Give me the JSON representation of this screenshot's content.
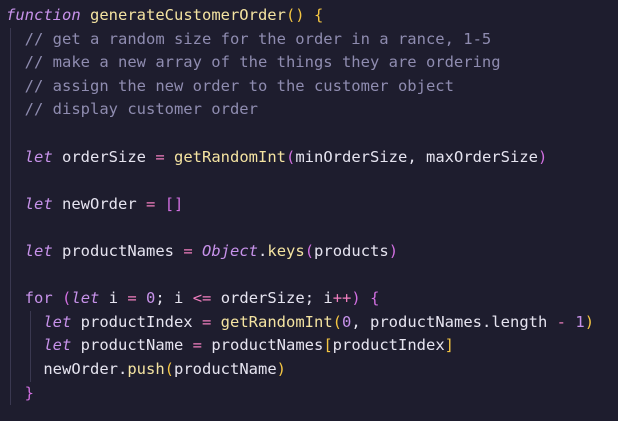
{
  "code": {
    "lines": [
      [
        {
          "c": "tok-kw",
          "t": "function"
        },
        {
          "c": "tok-var",
          "t": " "
        },
        {
          "c": "tok-fn",
          "t": "generateCustomerOrder"
        },
        {
          "c": "tok-paren",
          "t": "()"
        },
        {
          "c": "tok-var",
          "t": " "
        },
        {
          "c": "tok-brace",
          "t": "{"
        }
      ],
      [
        {
          "c": "tok-var",
          "t": "  "
        },
        {
          "c": "tok-comment",
          "t": "// get a random size for the order in a rance, 1-5"
        }
      ],
      [
        {
          "c": "tok-var",
          "t": "  "
        },
        {
          "c": "tok-comment",
          "t": "// make a new array of the things they are ordering"
        }
      ],
      [
        {
          "c": "tok-var",
          "t": "  "
        },
        {
          "c": "tok-comment",
          "t": "// assign the new order to the customer object"
        }
      ],
      [
        {
          "c": "tok-var",
          "t": "  "
        },
        {
          "c": "tok-comment",
          "t": "// display customer order"
        }
      ],
      [],
      [
        {
          "c": "tok-var",
          "t": "  "
        },
        {
          "c": "tok-kw",
          "t": "let"
        },
        {
          "c": "tok-var",
          "t": " orderSize "
        },
        {
          "c": "tok-op",
          "t": "="
        },
        {
          "c": "tok-var",
          "t": " "
        },
        {
          "c": "tok-fn",
          "t": "getRandomInt"
        },
        {
          "c": "tok-paren2",
          "t": "("
        },
        {
          "c": "tok-var",
          "t": "minOrderSize, maxOrderSize"
        },
        {
          "c": "tok-paren2",
          "t": ")"
        }
      ],
      [],
      [
        {
          "c": "tok-var",
          "t": "  "
        },
        {
          "c": "tok-kw",
          "t": "let"
        },
        {
          "c": "tok-var",
          "t": " newOrder "
        },
        {
          "c": "tok-op",
          "t": "="
        },
        {
          "c": "tok-var",
          "t": " "
        },
        {
          "c": "tok-bracket",
          "t": "[]"
        }
      ],
      [],
      [
        {
          "c": "tok-var",
          "t": "  "
        },
        {
          "c": "tok-kw",
          "t": "let"
        },
        {
          "c": "tok-var",
          "t": " productNames "
        },
        {
          "c": "tok-op",
          "t": "="
        },
        {
          "c": "tok-var",
          "t": " "
        },
        {
          "c": "tok-obj",
          "t": "Object"
        },
        {
          "c": "tok-punct",
          "t": "."
        },
        {
          "c": "tok-method",
          "t": "keys"
        },
        {
          "c": "tok-paren2",
          "t": "("
        },
        {
          "c": "tok-var",
          "t": "products"
        },
        {
          "c": "tok-paren2",
          "t": ")"
        }
      ],
      [],
      [
        {
          "c": "tok-var",
          "t": "  "
        },
        {
          "c": "tok-for",
          "t": "for"
        },
        {
          "c": "tok-var",
          "t": " "
        },
        {
          "c": "tok-paren2",
          "t": "("
        },
        {
          "c": "tok-kw",
          "t": "let"
        },
        {
          "c": "tok-var",
          "t": " i "
        },
        {
          "c": "tok-op",
          "t": "="
        },
        {
          "c": "tok-var",
          "t": " "
        },
        {
          "c": "tok-num",
          "t": "0"
        },
        {
          "c": "tok-punct",
          "t": "; i "
        },
        {
          "c": "tok-op",
          "t": "<="
        },
        {
          "c": "tok-var",
          "t": " orderSize; i"
        },
        {
          "c": "tok-op",
          "t": "++"
        },
        {
          "c": "tok-paren2",
          "t": ")"
        },
        {
          "c": "tok-var",
          "t": " "
        },
        {
          "c": "tok-brace2",
          "t": "{"
        }
      ],
      [
        {
          "c": "tok-var",
          "t": "    "
        },
        {
          "c": "tok-kw",
          "t": "let"
        },
        {
          "c": "tok-var",
          "t": " productIndex "
        },
        {
          "c": "tok-op",
          "t": "="
        },
        {
          "c": "tok-var",
          "t": " "
        },
        {
          "c": "tok-fn",
          "t": "getRandomInt"
        },
        {
          "c": "tok-paren",
          "t": "("
        },
        {
          "c": "tok-num",
          "t": "0"
        },
        {
          "c": "tok-var",
          "t": ", productNames."
        },
        {
          "c": "tok-var",
          "t": "length "
        },
        {
          "c": "tok-op",
          "t": "-"
        },
        {
          "c": "tok-var",
          "t": " "
        },
        {
          "c": "tok-num",
          "t": "1"
        },
        {
          "c": "tok-paren",
          "t": ")"
        }
      ],
      [
        {
          "c": "tok-var",
          "t": "    "
        },
        {
          "c": "tok-kw",
          "t": "let"
        },
        {
          "c": "tok-var",
          "t": " productName "
        },
        {
          "c": "tok-op",
          "t": "="
        },
        {
          "c": "tok-var",
          "t": " productNames"
        },
        {
          "c": "tok-paren",
          "t": "["
        },
        {
          "c": "tok-var",
          "t": "productIndex"
        },
        {
          "c": "tok-paren",
          "t": "]"
        }
      ],
      [
        {
          "c": "tok-var",
          "t": "    newOrder."
        },
        {
          "c": "tok-method",
          "t": "push"
        },
        {
          "c": "tok-paren",
          "t": "("
        },
        {
          "c": "tok-var",
          "t": "productName"
        },
        {
          "c": "tok-paren",
          "t": ")"
        }
      ],
      [
        {
          "c": "tok-var",
          "t": "  "
        },
        {
          "c": "tok-brace2",
          "t": "}"
        }
      ]
    ]
  }
}
